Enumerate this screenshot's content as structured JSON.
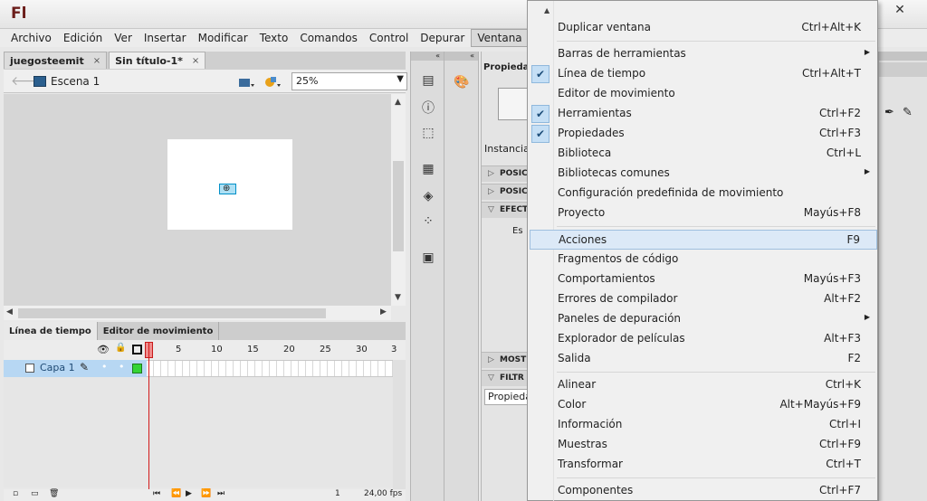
{
  "app": {
    "logo": "Fl",
    "close_glyph": "✕"
  },
  "menubar": [
    {
      "label": "Archivo"
    },
    {
      "label": "Edición"
    },
    {
      "label": "Ver"
    },
    {
      "label": "Insertar"
    },
    {
      "label": "Modificar"
    },
    {
      "label": "Texto"
    },
    {
      "label": "Comandos"
    },
    {
      "label": "Control"
    },
    {
      "label": "Depurar"
    },
    {
      "label": "Ventana"
    }
  ],
  "doc_tabs": [
    {
      "label": "juegosteemit",
      "close": "×"
    },
    {
      "label": "Sin título-1*",
      "close": "×"
    }
  ],
  "edit_bar": {
    "scene": "Escena 1",
    "zoom": "25%"
  },
  "timeline": {
    "tabs": [
      "Línea de tiempo",
      "Editor de movimiento"
    ],
    "ruler": [
      "5",
      "10",
      "15",
      "20",
      "25",
      "30",
      "3"
    ],
    "layer": "Capa 1",
    "frame": "1",
    "fps": "24,00 fps"
  },
  "properties": {
    "tab": "Propieda",
    "instance_label": "Instancia",
    "sections": [
      "POSIC",
      "POSIC",
      "EFECT",
      "MOST",
      "FILTR"
    ],
    "small": "Es",
    "filter_field": "Propieda"
  },
  "menu": {
    "groups": [
      [
        {
          "label": "Duplicar ventana",
          "shortcut": "Ctrl+Alt+K"
        }
      ],
      [
        {
          "label": "Barras de herramientas",
          "shortcut": "",
          "submenu": "▶"
        },
        {
          "label": "Línea de tiempo",
          "shortcut": "Ctrl+Alt+T",
          "check": "✔"
        },
        {
          "label": "Editor de movimiento",
          "shortcut": ""
        },
        {
          "label": "Herramientas",
          "shortcut": "Ctrl+F2",
          "check": "✔"
        },
        {
          "label": "Propiedades",
          "shortcut": "Ctrl+F3",
          "check": "✔"
        },
        {
          "label": "Biblioteca",
          "shortcut": "Ctrl+L"
        },
        {
          "label": "Bibliotecas comunes",
          "shortcut": "",
          "submenu": "▶"
        },
        {
          "label": "Configuración predefinida de movimiento",
          "shortcut": ""
        },
        {
          "label": "Proyecto",
          "shortcut": "Mayús+F8"
        }
      ],
      [
        {
          "label": "Acciones",
          "shortcut": "F9",
          "highlighted": true
        },
        {
          "label": "Fragmentos de código",
          "shortcut": ""
        },
        {
          "label": "Comportamientos",
          "shortcut": "Mayús+F3"
        },
        {
          "label": "Errores de compilador",
          "shortcut": "Alt+F2"
        },
        {
          "label": "Paneles de depuración",
          "shortcut": "",
          "submenu": "▶"
        },
        {
          "label": "Explorador de películas",
          "shortcut": "Alt+F3"
        },
        {
          "label": "Salida",
          "shortcut": "F2"
        }
      ],
      [
        {
          "label": "Alinear",
          "shortcut": "Ctrl+K"
        },
        {
          "label": "Color",
          "shortcut": "Alt+Mayús+F9"
        },
        {
          "label": "Información",
          "shortcut": "Ctrl+I"
        },
        {
          "label": "Muestras",
          "shortcut": "Ctrl+F9"
        },
        {
          "label": "Transformar",
          "shortcut": "Ctrl+T"
        }
      ],
      [
        {
          "label": "Componentes",
          "shortcut": "Ctrl+F7"
        }
      ]
    ]
  },
  "colors": {
    "menu_highlight": "#dce9f7",
    "check_bg": "#c5dff5",
    "layer_row": "#b7d7f3",
    "playhead": "#d21a1a",
    "logo": "#6b1d1a"
  }
}
